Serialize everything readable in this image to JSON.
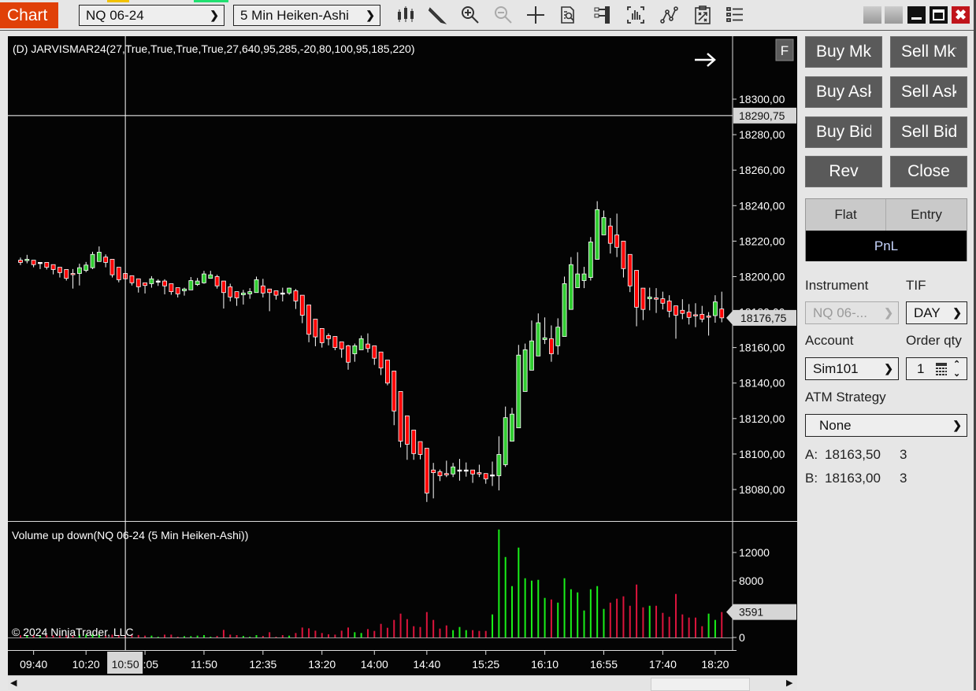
{
  "toolbar": {
    "chart_tab": "Chart",
    "instrument": "NQ 06-24",
    "bar_type": "5 Min Heiken-Ashi",
    "icons": [
      "bar-type-icon",
      "drawing-tools-icon",
      "zoom-in-icon",
      "zoom-out-icon",
      "crosshair-icon",
      "data-box-icon",
      "chart-trader-icon",
      "indicators-icon",
      "strategies-icon",
      "templates-icon",
      "properties-icon"
    ]
  },
  "colors": {
    "chart_tab": "#e04008",
    "up": "#32cd32",
    "down": "#ff0000",
    "vol_up": "#19f019",
    "vol_down": "#dc143c",
    "close": "#c8102e"
  },
  "chart_data": {
    "type": "candlestick",
    "indicator_label": "(D) JARVISMAR24(27,True,True,True,True,27,640,95,285,-20,80,100,95,185,220)",
    "flatten_button": "F",
    "price_ticks": [
      "18300,00",
      "18280,00",
      "18260,00",
      "18240,00",
      "18220,00",
      "18200,00",
      "18180,00",
      "18160,00",
      "18140,00",
      "18120,00",
      "18100,00",
      "18080,00"
    ],
    "current_price": "18176,75",
    "crosshair_price": "18290,75",
    "crosshair_time": "10:50",
    "time_labels": [
      "09:40",
      "10:20",
      "11:05",
      "11:50",
      "12:35",
      "13:20",
      "14:00",
      "14:40",
      "15:25",
      "16:10",
      "16:55",
      "17:40",
      "18:20"
    ],
    "first_bar_time": "09:30",
    "bar_minutes": 5,
    "ohlc": [
      [
        18209.25,
        18210.75,
        18206.5,
        18208
      ],
      [
        18209,
        18212.25,
        18207.5,
        18209.75
      ],
      [
        18209.25,
        18209.25,
        18205.25,
        18206.75
      ],
      [
        18208,
        18208,
        18204.25,
        18208
      ],
      [
        18208,
        18208,
        18204,
        18205.25
      ],
      [
        18206.75,
        18206.75,
        18201.25,
        18204
      ],
      [
        18205.25,
        18205.25,
        18199.5,
        18202.25
      ],
      [
        18204,
        18204,
        18197.75,
        18199
      ],
      [
        18201.75,
        18204.25,
        18193.25,
        18201.25
      ],
      [
        18201.75,
        18207.25,
        18195,
        18205
      ],
      [
        18203.5,
        18208.25,
        18202.5,
        18206.5
      ],
      [
        18205,
        18214,
        18204.25,
        18212.5
      ],
      [
        18208.5,
        18217,
        18208.5,
        18213.75
      ],
      [
        18211,
        18212.5,
        18205.25,
        18208
      ],
      [
        18209.75,
        18209.75,
        18199.5,
        18201
      ],
      [
        18205.25,
        18205.25,
        18196.75,
        18198.25
      ],
      [
        18201.75,
        18201.75,
        18198.75,
        18198.75
      ],
      [
        18200.5,
        18200.5,
        18195,
        18196.5
      ],
      [
        18198.75,
        18198.75,
        18191,
        18194.25
      ],
      [
        18196.5,
        18196.5,
        18190.5,
        18195
      ],
      [
        18196,
        18200.25,
        18193.75,
        18198.75
      ],
      [
        18197.5,
        18198.5,
        18194.75,
        18197.5
      ],
      [
        18197.5,
        18198.5,
        18190,
        18194.75
      ],
      [
        18196,
        18196,
        18189.75,
        18191.5
      ],
      [
        18193.75,
        18193.75,
        18188.25,
        18190.25
      ],
      [
        18192,
        18193.75,
        18189.25,
        18193
      ],
      [
        18192.5,
        18199.75,
        18192.5,
        18197.75
      ],
      [
        18195.5,
        18199.25,
        18194.75,
        18197.5
      ],
      [
        18196.5,
        18203.25,
        18196,
        18201.5
      ],
      [
        18199,
        18203.25,
        18199,
        18201
      ],
      [
        18200,
        18201,
        18193.25,
        18194.75
      ],
      [
        18197.5,
        18197.5,
        18182,
        18191
      ],
      [
        18194.25,
        18196,
        18186,
        18188.5
      ],
      [
        18191.5,
        18191.5,
        18183.5,
        18188
      ],
      [
        18189.75,
        18192.5,
        18184.25,
        18190.75
      ],
      [
        18190.25,
        18193.5,
        18187.5,
        18191.5
      ],
      [
        18191,
        18200,
        18191,
        18198.25
      ],
      [
        18194.75,
        18198.75,
        18188.25,
        18190.75
      ],
      [
        18193,
        18193,
        18180.5,
        18191
      ],
      [
        18192,
        18192,
        18187,
        18189.5
      ],
      [
        18190.75,
        18193.75,
        18186,
        18190.75
      ],
      [
        18190.75,
        18193.75,
        18189.75,
        18193.5
      ],
      [
        18192,
        18193,
        18181.75,
        18186.25
      ],
      [
        18189.5,
        18189.5,
        18173.75,
        18178.25
      ],
      [
        18184,
        18184,
        18163,
        18167.5
      ],
      [
        18176,
        18176,
        18160.75,
        18166
      ],
      [
        18170.75,
        18170.75,
        18160,
        18162.75
      ],
      [
        18166.75,
        18168,
        18161.25,
        18165
      ],
      [
        18166.25,
        18166.25,
        18158.5,
        18160
      ],
      [
        18163.25,
        18163.25,
        18154.25,
        18159.25
      ],
      [
        18161,
        18161.5,
        18147.5,
        18151.75
      ],
      [
        18156.5,
        18162.25,
        18152,
        18161
      ],
      [
        18158.75,
        18166.75,
        18158.75,
        18165
      ],
      [
        18162,
        18168,
        18157.25,
        18159.5
      ],
      [
        18161,
        18161,
        18150.25,
        18154
      ],
      [
        18157.5,
        18157.5,
        18144.5,
        18148.5
      ],
      [
        18153,
        18153,
        18138.75,
        18140
      ],
      [
        18146.75,
        18146.75,
        18116.25,
        18124.25
      ],
      [
        18135.25,
        18135.25,
        18103.75,
        18107.25
      ],
      [
        18121.5,
        18121.5,
        18096.75,
        18105.5
      ],
      [
        18113.5,
        18113.5,
        18096.75,
        18100.25
      ],
      [
        18107,
        18107,
        18097,
        18099.75
      ],
      [
        18103.25,
        18103.25,
        18073,
        18078
      ],
      [
        18091,
        18095,
        18075,
        18089.5
      ],
      [
        18090,
        18091.25,
        18084.75,
        18087.75
      ],
      [
        18089,
        18096.25,
        18087,
        18088.25
      ],
      [
        18088.75,
        18095,
        18087,
        18092.75
      ],
      [
        18091,
        18097.25,
        18085,
        18091
      ],
      [
        18091,
        18095.25,
        18087.25,
        18091
      ],
      [
        18091,
        18091,
        18083.75,
        18088.75
      ],
      [
        18089.5,
        18094,
        18087,
        18088.75
      ],
      [
        18089,
        18089,
        18083.25,
        18086
      ],
      [
        18088.25,
        18095.75,
        18082,
        18088.25
      ],
      [
        18087.75,
        18110,
        18079.5,
        18099.75
      ],
      [
        18094,
        18126.75,
        18092.75,
        18120.5
      ],
      [
        18107.25,
        18126,
        18107.25,
        18122.5
      ],
      [
        18114.75,
        18161.5,
        18114.75,
        18155.75
      ],
      [
        18135.25,
        18162.25,
        18135.25,
        18158.75
      ],
      [
        18147.25,
        18175.25,
        18147.25,
        18163.75
      ],
      [
        18155.25,
        18179.25,
        18155.25,
        18174
      ],
      [
        18164.5,
        18177,
        18162,
        18165.5
      ],
      [
        18165,
        18172.5,
        18152,
        18156.5
      ],
      [
        18161,
        18176.5,
        18156,
        18171.5
      ],
      [
        18166.25,
        18200,
        18166.25,
        18196
      ],
      [
        18181.5,
        18211,
        18181.5,
        18206.75
      ],
      [
        18193.75,
        18213.75,
        18193.75,
        18201.5
      ],
      [
        18197.75,
        18205.5,
        18193.5,
        18201.5
      ],
      [
        18199.5,
        18222.25,
        18197.75,
        18219.5
      ],
      [
        18209.75,
        18242.5,
        18209.75,
        18237.75
      ],
      [
        18223.5,
        18237.25,
        18223.5,
        18233.25
      ],
      [
        18228.5,
        18233,
        18213,
        18218.75
      ],
      [
        18223.5,
        18235.5,
        18211,
        18216.5
      ],
      [
        18220,
        18220,
        18199.5,
        18204.5
      ],
      [
        18212.5,
        18212.5,
        18191.25,
        18194.75
      ],
      [
        18203.5,
        18203.5,
        18172,
        18182.75
      ],
      [
        18193.5,
        18193.5,
        18175.5,
        18181.5
      ],
      [
        18187.5,
        18193.75,
        18181,
        18188.5
      ],
      [
        18188,
        18193.5,
        18179.5,
        18187.25
      ],
      [
        18187.5,
        18191.5,
        18181.5,
        18185
      ],
      [
        18186.25,
        18189.5,
        18177,
        18180.5
      ],
      [
        18183.5,
        18183.5,
        18165,
        18178.25
      ],
      [
        18181,
        18187.25,
        18176,
        18179.25
      ],
      [
        18180,
        18184.5,
        18173,
        18177
      ],
      [
        18178.5,
        18185,
        18171.5,
        18178.25
      ],
      [
        18178.75,
        18183.5,
        18174.25,
        18176
      ],
      [
        18177.75,
        18180,
        18166.75,
        18177.5
      ],
      [
        18178,
        18189.5,
        18174,
        18185.75
      ],
      [
        18181.75,
        18191.5,
        18174.25,
        18176.75
      ]
    ],
    "volume_label": "Volume up down(NQ 06-24 (5 Min Heiken-Ashi))",
    "volume_ticks": [
      "12000",
      "8000",
      "0"
    ],
    "volume_current": "3591",
    "volume": [
      300,
      250,
      300,
      200,
      350,
      300,
      250,
      350,
      300,
      450,
      400,
      500,
      450,
      300,
      400,
      350,
      250,
      300,
      350,
      260,
      260,
      110,
      400,
      400,
      110,
      185,
      185,
      260,
      333,
      110,
      220,
      1073,
      400,
      333,
      220,
      110,
      333,
      220,
      740,
      110,
      333,
      260,
      630,
      1406,
      1295,
      962,
      630,
      444,
      400,
      962,
      1406,
      740,
      630,
      1184,
      925,
      1924,
      1369,
      2479,
      3367,
      2590,
      1591,
      1480,
      3589,
      2479,
      1258,
      1702,
      1036,
      1480,
      1036,
      1036,
      925,
      925,
      3256,
      15244,
      11359,
      7252,
      12691,
      8362,
      8029,
      8140,
      5587,
      5365,
      4921,
      8362,
      6808,
      6364,
      3811,
      6808,
      7252,
      4033,
      4921,
      5476,
      5809,
      4477,
      7474,
      4255,
      4477,
      4477,
      3478,
      2923,
      6142,
      3256,
      2812,
      2812,
      1591,
      3367,
      2479,
      3591
    ],
    "volume_up": [
      0,
      1,
      0,
      1,
      0,
      0,
      0,
      0,
      0,
      1,
      1,
      1,
      1,
      0,
      0,
      0,
      0,
      0,
      0,
      0,
      1,
      1,
      0,
      0,
      0,
      1,
      1,
      1,
      1,
      1,
      0,
      0,
      0,
      0,
      1,
      1,
      1,
      0,
      0,
      0,
      0,
      1,
      0,
      0,
      0,
      0,
      0,
      0,
      0,
      0,
      0,
      1,
      1,
      0,
      0,
      0,
      0,
      0,
      0,
      0,
      0,
      0,
      0,
      0,
      0,
      0,
      1,
      1,
      1,
      0,
      0,
      0,
      1,
      1,
      1,
      1,
      1,
      1,
      1,
      1,
      1,
      0,
      1,
      1,
      1,
      1,
      1,
      1,
      1,
      1,
      0,
      0,
      0,
      0,
      0,
      0,
      1,
      0,
      0,
      0,
      0,
      0,
      0,
      0,
      0,
      1,
      1,
      0
    ],
    "copyright": "© 2024 NinjaTrader, LLC"
  },
  "trader": {
    "buttons": [
      "Buy Mkt",
      "Sell Mkt",
      "Buy Ask",
      "Sell Ask",
      "Buy Bid",
      "Sell Bid",
      "Rev",
      "Close"
    ],
    "position_headers": [
      "Flat",
      "Entry"
    ],
    "pnl": "PnL",
    "instrument_label": "Instrument",
    "instrument_value": "NQ 06-...",
    "tif_label": "TIF",
    "tif_value": "DAY",
    "account_label": "Account",
    "account_value": "Sim101",
    "qty_label": "Order qty",
    "qty_value": "1",
    "atm_label": "ATM Strategy",
    "atm_value": "None",
    "ask_label": "A:",
    "ask_price": "18163,50",
    "ask_size": "3",
    "bid_label": "B:",
    "bid_price": "18163,00",
    "bid_size": "3"
  }
}
